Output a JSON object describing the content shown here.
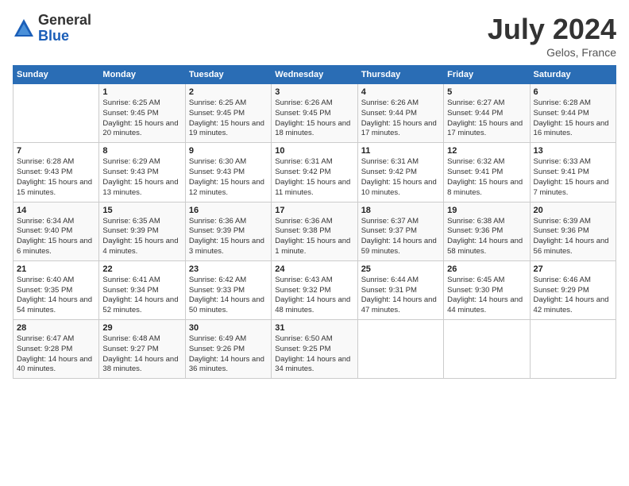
{
  "header": {
    "logo_general": "General",
    "logo_blue": "Blue",
    "month_title": "July 2024",
    "location": "Gelos, France"
  },
  "days_of_week": [
    "Sunday",
    "Monday",
    "Tuesday",
    "Wednesday",
    "Thursday",
    "Friday",
    "Saturday"
  ],
  "weeks": [
    [
      {
        "day": "",
        "info": ""
      },
      {
        "day": "1",
        "info": "Sunrise: 6:25 AM\nSunset: 9:45 PM\nDaylight: 15 hours and 20 minutes."
      },
      {
        "day": "2",
        "info": "Sunrise: 6:25 AM\nSunset: 9:45 PM\nDaylight: 15 hours and 19 minutes."
      },
      {
        "day": "3",
        "info": "Sunrise: 6:26 AM\nSunset: 9:45 PM\nDaylight: 15 hours and 18 minutes."
      },
      {
        "day": "4",
        "info": "Sunrise: 6:26 AM\nSunset: 9:44 PM\nDaylight: 15 hours and 17 minutes."
      },
      {
        "day": "5",
        "info": "Sunrise: 6:27 AM\nSunset: 9:44 PM\nDaylight: 15 hours and 17 minutes."
      },
      {
        "day": "6",
        "info": "Sunrise: 6:28 AM\nSunset: 9:44 PM\nDaylight: 15 hours and 16 minutes."
      }
    ],
    [
      {
        "day": "7",
        "info": "Sunrise: 6:28 AM\nSunset: 9:43 PM\nDaylight: 15 hours and 15 minutes."
      },
      {
        "day": "8",
        "info": "Sunrise: 6:29 AM\nSunset: 9:43 PM\nDaylight: 15 hours and 13 minutes."
      },
      {
        "day": "9",
        "info": "Sunrise: 6:30 AM\nSunset: 9:43 PM\nDaylight: 15 hours and 12 minutes."
      },
      {
        "day": "10",
        "info": "Sunrise: 6:31 AM\nSunset: 9:42 PM\nDaylight: 15 hours and 11 minutes."
      },
      {
        "day": "11",
        "info": "Sunrise: 6:31 AM\nSunset: 9:42 PM\nDaylight: 15 hours and 10 minutes."
      },
      {
        "day": "12",
        "info": "Sunrise: 6:32 AM\nSunset: 9:41 PM\nDaylight: 15 hours and 8 minutes."
      },
      {
        "day": "13",
        "info": "Sunrise: 6:33 AM\nSunset: 9:41 PM\nDaylight: 15 hours and 7 minutes."
      }
    ],
    [
      {
        "day": "14",
        "info": "Sunrise: 6:34 AM\nSunset: 9:40 PM\nDaylight: 15 hours and 6 minutes."
      },
      {
        "day": "15",
        "info": "Sunrise: 6:35 AM\nSunset: 9:39 PM\nDaylight: 15 hours and 4 minutes."
      },
      {
        "day": "16",
        "info": "Sunrise: 6:36 AM\nSunset: 9:39 PM\nDaylight: 15 hours and 3 minutes."
      },
      {
        "day": "17",
        "info": "Sunrise: 6:36 AM\nSunset: 9:38 PM\nDaylight: 15 hours and 1 minute."
      },
      {
        "day": "18",
        "info": "Sunrise: 6:37 AM\nSunset: 9:37 PM\nDaylight: 14 hours and 59 minutes."
      },
      {
        "day": "19",
        "info": "Sunrise: 6:38 AM\nSunset: 9:36 PM\nDaylight: 14 hours and 58 minutes."
      },
      {
        "day": "20",
        "info": "Sunrise: 6:39 AM\nSunset: 9:36 PM\nDaylight: 14 hours and 56 minutes."
      }
    ],
    [
      {
        "day": "21",
        "info": "Sunrise: 6:40 AM\nSunset: 9:35 PM\nDaylight: 14 hours and 54 minutes."
      },
      {
        "day": "22",
        "info": "Sunrise: 6:41 AM\nSunset: 9:34 PM\nDaylight: 14 hours and 52 minutes."
      },
      {
        "day": "23",
        "info": "Sunrise: 6:42 AM\nSunset: 9:33 PM\nDaylight: 14 hours and 50 minutes."
      },
      {
        "day": "24",
        "info": "Sunrise: 6:43 AM\nSunset: 9:32 PM\nDaylight: 14 hours and 48 minutes."
      },
      {
        "day": "25",
        "info": "Sunrise: 6:44 AM\nSunset: 9:31 PM\nDaylight: 14 hours and 47 minutes."
      },
      {
        "day": "26",
        "info": "Sunrise: 6:45 AM\nSunset: 9:30 PM\nDaylight: 14 hours and 44 minutes."
      },
      {
        "day": "27",
        "info": "Sunrise: 6:46 AM\nSunset: 9:29 PM\nDaylight: 14 hours and 42 minutes."
      }
    ],
    [
      {
        "day": "28",
        "info": "Sunrise: 6:47 AM\nSunset: 9:28 PM\nDaylight: 14 hours and 40 minutes."
      },
      {
        "day": "29",
        "info": "Sunrise: 6:48 AM\nSunset: 9:27 PM\nDaylight: 14 hours and 38 minutes."
      },
      {
        "day": "30",
        "info": "Sunrise: 6:49 AM\nSunset: 9:26 PM\nDaylight: 14 hours and 36 minutes."
      },
      {
        "day": "31",
        "info": "Sunrise: 6:50 AM\nSunset: 9:25 PM\nDaylight: 14 hours and 34 minutes."
      },
      {
        "day": "",
        "info": ""
      },
      {
        "day": "",
        "info": ""
      },
      {
        "day": "",
        "info": ""
      }
    ]
  ]
}
